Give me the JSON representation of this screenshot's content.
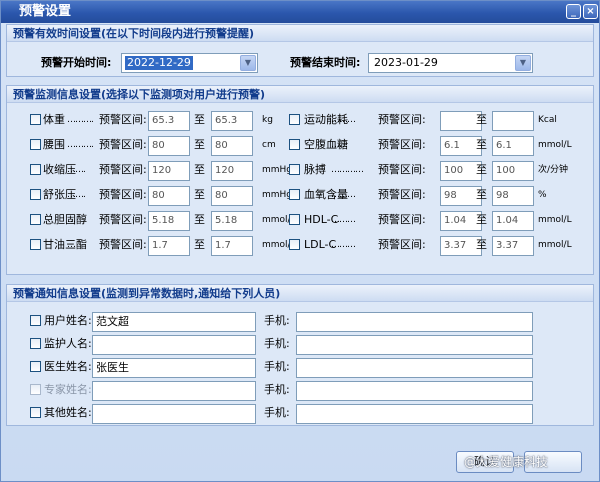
{
  "window": {
    "title": "预警设置",
    "minimize_glyph": "_",
    "close_glyph": "×"
  },
  "time_section": {
    "title": "预警有效时间设置(在以下时间段内进行预警提醒)",
    "start_label": "预警开始时间:",
    "start_value": "2022-12-29",
    "end_label": "预警结束时间:",
    "end_value": "2023-01-29"
  },
  "monitor_section": {
    "title": "预警监测信息设置(选择以下监测项对用户进行预警)",
    "range_label": "预警区间:",
    "to_label": "至",
    "left_items": [
      {
        "name": "体重",
        "dots": "……….",
        "from": "65.3",
        "to": "65.3",
        "unit": "kg"
      },
      {
        "name": "腰围",
        "dots": "……….",
        "from": "80",
        "to": "80",
        "unit": "cm"
      },
      {
        "name": "收缩压",
        "dots": "…….",
        "from": "120",
        "to": "120",
        "unit": "mmHg"
      },
      {
        "name": "舒张压",
        "dots": "…….",
        "from": "80",
        "to": "80",
        "unit": "mmHg"
      },
      {
        "name": "总胆固醇",
        "dots": "…",
        "from": "5.18",
        "to": "5.18",
        "unit": "mmol/L"
      },
      {
        "name": "甘油三酯",
        "dots": "…",
        "from": "1.7",
        "to": "1.7",
        "unit": "mmol/L"
      }
    ],
    "right_items": [
      {
        "name": "运动能耗",
        "dots": "………",
        "from": "",
        "to": "",
        "unit": "Kcal"
      },
      {
        "name": "空腹血糖",
        "dots": "……",
        "from": "6.1",
        "to": "6.1",
        "unit": "mmol/L"
      },
      {
        "name": "脉搏",
        "dots": "…………",
        "from": "100",
        "to": "100",
        "unit": "次/分钟"
      },
      {
        "name": "血氧含量",
        "dots": "………",
        "from": "98",
        "to": "98",
        "unit": "%"
      },
      {
        "name": "HDL-C",
        "dots": "………",
        "from": "1.04",
        "to": "1.04",
        "unit": "mmol/L"
      },
      {
        "name": "LDL-C",
        "dots": "………",
        "from": "3.37",
        "to": "3.37",
        "unit": "mmol/L"
      }
    ]
  },
  "notify_section": {
    "title": "预警通知信息设置(监测到异常数据时,通知给下列人员)",
    "phone_label": "手机:",
    "rows": [
      {
        "label": "用户姓名:",
        "name": "范文超",
        "phone": "",
        "disabled": false
      },
      {
        "label": "监护人名:",
        "name": "",
        "phone": "",
        "disabled": false
      },
      {
        "label": "医生姓名:",
        "name": "张医生",
        "phone": "",
        "disabled": false
      },
      {
        "label": "专家姓名:",
        "name": "",
        "phone": "",
        "disabled": true
      },
      {
        "label": "其他姓名:",
        "name": "",
        "phone": "",
        "disabled": false
      }
    ]
  },
  "footer": {
    "ok_label": "确认",
    "watermark": "@大爱健康科技"
  },
  "colors": {
    "title_bar": "#2b57ad",
    "section_title": "#123c8c",
    "selection": "#316ac5",
    "window_bg": "#d6e4f6"
  }
}
